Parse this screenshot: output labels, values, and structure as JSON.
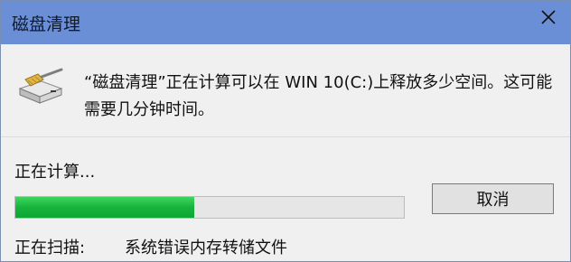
{
  "window": {
    "title": "磁盘清理",
    "title_bar_color": "#6b8fd6"
  },
  "close_icon": "close-x-icon",
  "disk_icon": "disk-cleanup-icon",
  "message": "“磁盘清理”正在计算可以在 WIN 10(C:)上释放多少空间。这可能需要几分钟时间。",
  "status": {
    "calculating": "正在计算...",
    "scanning_label": "正在扫描:",
    "scanning_item": "系统错误内存转储文件"
  },
  "progress": {
    "percent": 46,
    "color": "#16b43c"
  },
  "cancel_button": {
    "label": "取消"
  }
}
